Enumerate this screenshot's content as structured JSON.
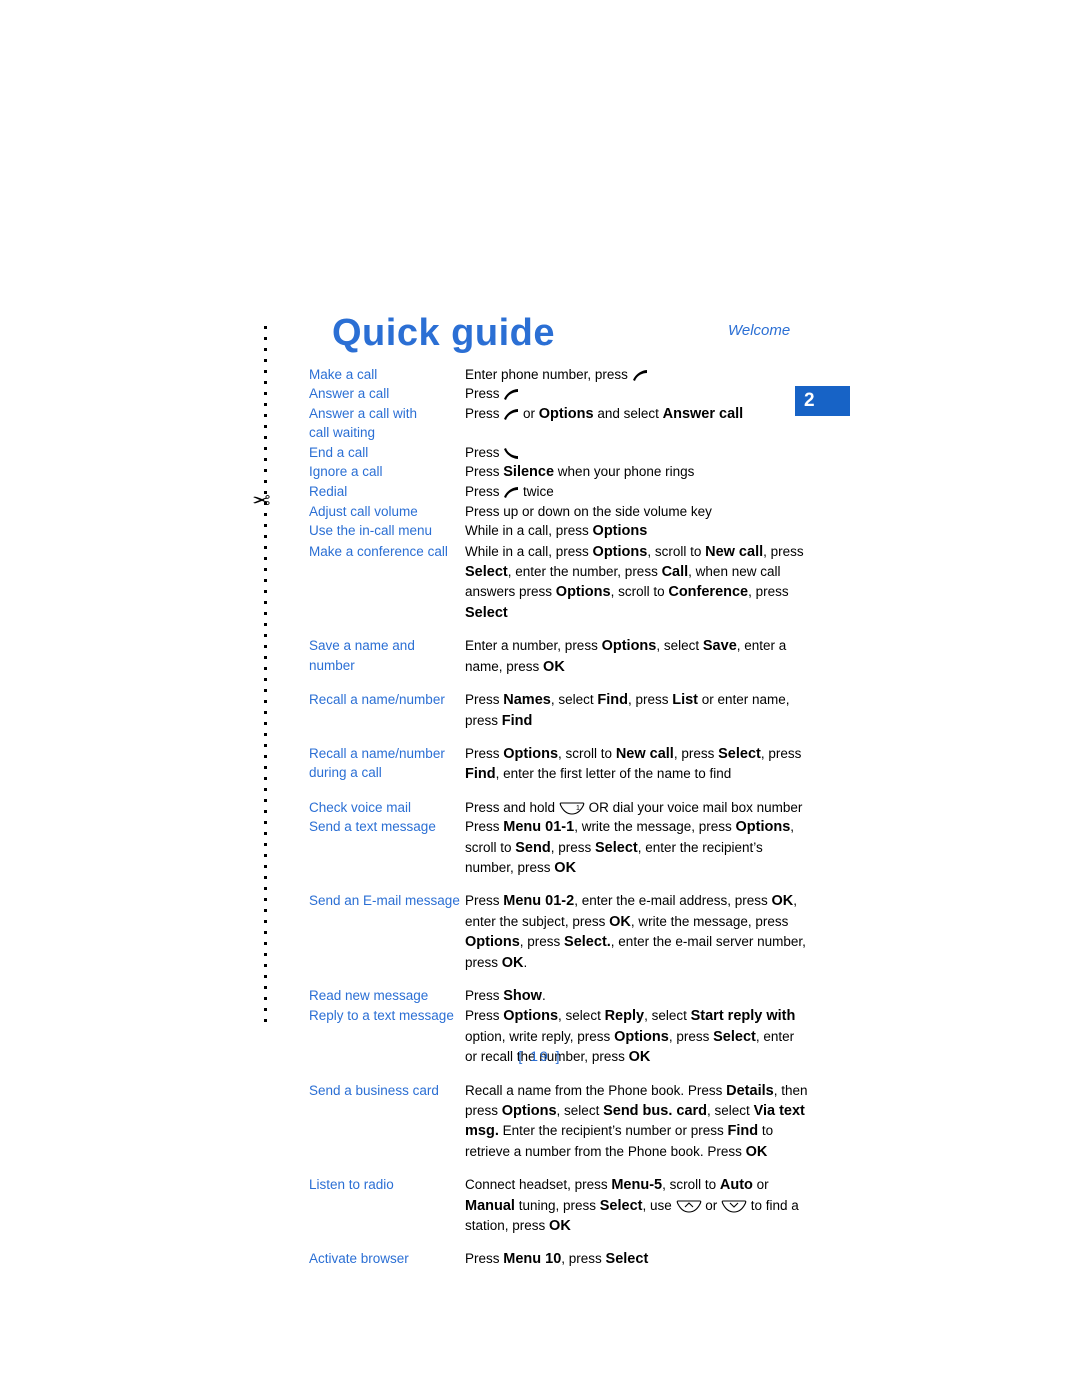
{
  "header": {
    "title": "Quick guide",
    "welcome": "Welcome",
    "chapter_number": "2",
    "accent_color": "#2b6fd4"
  },
  "page_number": "[ 19 ]",
  "rows": [
    {
      "label": "Make a call",
      "desc": "Enter phone number, press ",
      "icon_after": "call-send-key"
    },
    {
      "label": "Answer a call",
      "desc": "Press ",
      "icon_after": "call-send-key"
    },
    {
      "label": "Answer a call with call waiting",
      "desc": "Press <icon:call-send-key> or <b>Options</b> and select <b>Answer call</b>"
    },
    {
      "label": "End a call",
      "desc": "Press ",
      "icon_after": "call-end-key"
    },
    {
      "label": "Ignore a call",
      "desc": "Press <b>Silence</b> when your phone rings"
    },
    {
      "label": "Redial",
      "desc": "Press <icon:call-send-key> twice"
    },
    {
      "label": "Adjust call volume",
      "desc": "Press up or down on the side volume key"
    },
    {
      "label": "Use the in-call menu",
      "desc": "While in a call, press <b>Options</b>"
    },
    {
      "label": "Make a conference call",
      "desc": "While in a call, press <b>Options</b>, scroll to <b>New call</b>, press <b>Select</b>, enter the number, press <b>Call</b>, when new call answers press <b>Options</b>, scroll to <b>Conference</b>, press <b>Select</b>"
    },
    {
      "label": "Save a name and number",
      "desc": "Enter a number, press <b>Options</b>, select <b>Save</b>, enter a name, press <b>OK</b>"
    },
    {
      "label": "Recall a name/number",
      "desc": "Press <b>Names</b>, select <b>Find</b>, press <b>List</b> or enter name, press <b>Find</b>"
    },
    {
      "label": "Recall a name/number during a call",
      "desc": "Press <b>Options</b>, scroll to <b>New call</b>, press <b>Select</b>, press <b>Find</b>, enter the first letter of the name to find"
    },
    {
      "label": "Check voice mail",
      "desc": "Press and hold <icon:key-1> OR dial your voice mail box number"
    },
    {
      "label": "Send a text message",
      "desc": "Press <b>Menu 01-1</b>, write the message, press <b>Options</b>, scroll to <b>Send</b>, press <b>Select</b>, enter the recipient's number, press <b>OK</b>"
    },
    {
      "label": "Send an E-mail message",
      "desc": "Press <b>Menu 01-2</b>, enter the e-mail address, press <b>OK</b>, enter the subject, press <b>OK</b>, write the message, press <b>Options</b>, press <b>Select.</b>, enter the e-mail server number, press <b>OK</b>."
    },
    {
      "label": "Read new message",
      "desc": "Press <b>Show</b>."
    },
    {
      "label": "Reply to a text message",
      "desc": "Press <b>Options</b>, select <b>Reply</b>, select <b>Start reply with</b> option, write reply, press <b>Options</b>, press <b>Select</b>, enter or recall the number, press <b>OK</b>"
    },
    {
      "label": "Send a business card",
      "desc": "Recall a name from the Phone book. Press <b>Details</b>, then press <b>Options</b>, select <b>Send bus. card</b>, select <b>Via text msg.</b> Enter the recipient's number or press <b>Find</b> to retrieve a number from the Phone book. Press <b>OK</b>"
    },
    {
      "label": "Listen to radio",
      "desc": "Connect headset, press <b>Menu-5</b>, scroll to <b>Auto</b> or <b>Manual</b> tuning, press <b>Select</b>, use <icon:scroll-up-key> or <icon:scroll-down-key> to find a station, press <b>OK</b>"
    },
    {
      "label": "Activate browser",
      "desc": "Press <b>Menu 10</b>, press <b>Select</b>"
    }
  ]
}
